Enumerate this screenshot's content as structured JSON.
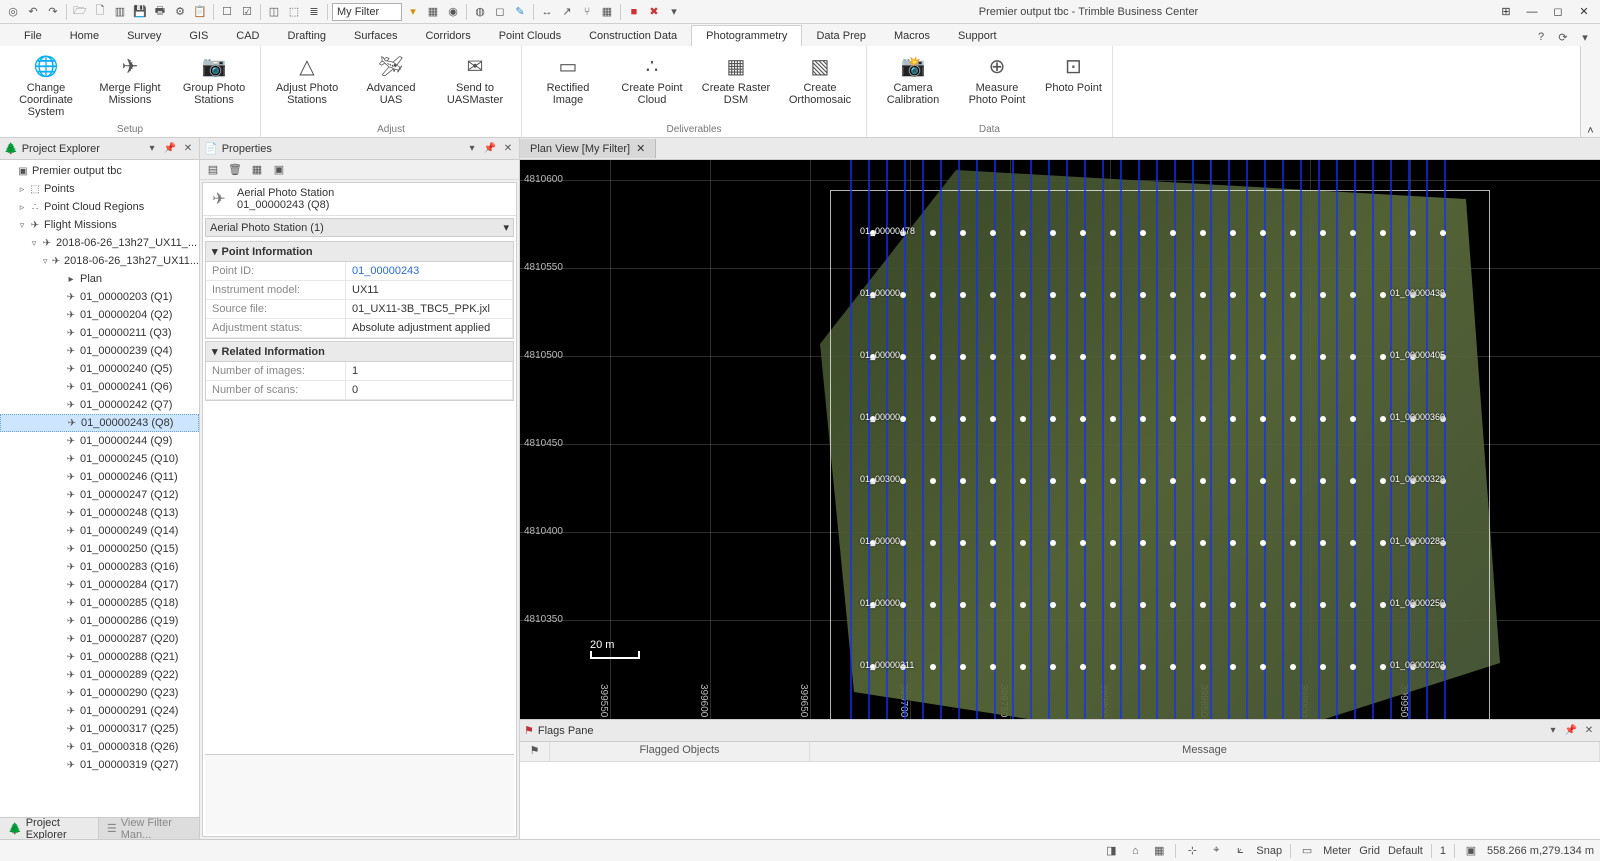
{
  "app": {
    "title": "Premier output tbc - Trimble Business Center"
  },
  "quick_access": {
    "filter": "My Filter",
    "icons": [
      "target",
      "undo",
      "redo",
      "open",
      "new",
      "folder",
      "floppy",
      "print",
      "gear",
      "clipboard",
      "selectA",
      "selectB",
      "view3d",
      "cube",
      "layers",
      "filter-dd",
      "sel-by",
      "clear",
      "globe",
      "box",
      "layer",
      "edit",
      "dim",
      "path",
      "branch",
      "grid",
      "rec",
      "stop",
      "play"
    ]
  },
  "tabs": [
    "File",
    "Home",
    "Survey",
    "GIS",
    "CAD",
    "Drafting",
    "Surfaces",
    "Corridors",
    "Point Clouds",
    "Construction Data",
    "Photogrammetry",
    "Data Prep",
    "Macros",
    "Support"
  ],
  "active_tab": "Photogrammetry",
  "ribbon": {
    "groups": [
      {
        "name": "Setup",
        "items": [
          {
            "icon": "globe",
            "label": "Change Coordinate System"
          },
          {
            "icon": "merge",
            "label": "Merge Flight Missions"
          },
          {
            "icon": "stations",
            "label": "Group Photo Stations"
          }
        ]
      },
      {
        "name": "Adjust",
        "items": [
          {
            "icon": "tripod",
            "label": "Adjust Photo Stations"
          },
          {
            "icon": "uas",
            "label": "Advanced UAS"
          },
          {
            "icon": "send",
            "label": "Send to UASMaster"
          }
        ]
      },
      {
        "name": "Deliverables",
        "items": [
          {
            "icon": "rect",
            "label": "Rectified Image"
          },
          {
            "icon": "cloud",
            "label": "Create Point Cloud"
          },
          {
            "icon": "dsm",
            "label": "Create Raster DSM"
          },
          {
            "icon": "ortho",
            "label": "Create Orthomosaic"
          }
        ]
      },
      {
        "name": "Data",
        "items": [
          {
            "icon": "camera",
            "label": "Camera Calibration"
          },
          {
            "icon": "measure",
            "label": "Measure Photo Point"
          },
          {
            "icon": "ppoint",
            "label": "Photo Point"
          }
        ]
      }
    ]
  },
  "explorer": {
    "title": "Project Explorer",
    "root": "Premier output tbc",
    "top_nodes": [
      "Points",
      "Point Cloud Regions",
      "Flight Missions"
    ],
    "mission": "2018-06-26_13h27_UX11_...",
    "mission_child": "2018-06-26_13h27_UX11...",
    "plan_label": "Plan",
    "photos": [
      "01_00000203 (Q1)",
      "01_00000204 (Q2)",
      "01_00000211 (Q3)",
      "01_00000239 (Q4)",
      "01_00000240 (Q5)",
      "01_00000241 (Q6)",
      "01_00000242 (Q7)",
      "01_00000243 (Q8)",
      "01_00000244 (Q9)",
      "01_00000245 (Q10)",
      "01_00000246 (Q11)",
      "01_00000247 (Q12)",
      "01_00000248 (Q13)",
      "01_00000249 (Q14)",
      "01_00000250 (Q15)",
      "01_00000283 (Q16)",
      "01_00000284 (Q17)",
      "01_00000285 (Q18)",
      "01_00000286 (Q19)",
      "01_00000287 (Q20)",
      "01_00000288 (Q21)",
      "01_00000289 (Q22)",
      "01_00000290 (Q23)",
      "01_00000291 (Q24)",
      "01_00000317 (Q25)",
      "01_00000318 (Q26)",
      "01_00000319 (Q27)"
    ],
    "selected": "01_00000243 (Q8)"
  },
  "bottom_tabs": {
    "a": "Project Explorer",
    "b": "View Filter Man..."
  },
  "properties": {
    "title": "Properties",
    "object_type": "Aerial Photo Station",
    "object_name": "01_00000243 (Q8)",
    "selector": "Aerial Photo Station (1)",
    "sections": [
      {
        "name": "Point Information",
        "rows": [
          {
            "k": "Point ID:",
            "v": "01_00000243",
            "link": true
          },
          {
            "k": "Instrument model:",
            "v": "UX11"
          },
          {
            "k": "Source file:",
            "v": "01_UX11-3B_TBC5_PPK.jxl"
          },
          {
            "k": "Adjustment status:",
            "v": "Absolute adjustment applied"
          }
        ]
      },
      {
        "name": "Related Information",
        "rows": [
          {
            "k": "Number of images:",
            "v": "1"
          },
          {
            "k": "Number of scans:",
            "v": "0"
          }
        ]
      }
    ]
  },
  "plan_view": {
    "tab": "Plan View [My Filter]",
    "scale": "20 m",
    "y_ticks": [
      "4810600",
      "4810550",
      "4810500",
      "4810450",
      "4810400",
      "4810350"
    ],
    "x_ticks": [
      "399550",
      "399600",
      "399650",
      "399700",
      "399750",
      "399800",
      "399850",
      "399900",
      "399950"
    ],
    "row_labels": [
      {
        "l": "01_00000478",
        "r": ""
      },
      {
        "l": "01_00000",
        "r": "01_00000439"
      },
      {
        "l": "01_00000",
        "r": "01_00000405"
      },
      {
        "l": "01_00000",
        "r": "01_00000360"
      },
      {
        "l": "01_00300",
        "r": "01_00000329"
      },
      {
        "l": "01_00000",
        "r": "01_00000283"
      },
      {
        "l": "01_00000",
        "r": "01_00000250"
      },
      {
        "l": "01_00000211",
        "r": "01_00000203"
      }
    ]
  },
  "flags": {
    "title": "Flags Pane",
    "col_a": "Flagged Objects",
    "col_b": "Message"
  },
  "statusbar": {
    "snap": "Snap",
    "meter": "Meter",
    "grid": "Grid",
    "default": "Default",
    "count": "1",
    "coords": "558.266 m,279.134 m"
  }
}
